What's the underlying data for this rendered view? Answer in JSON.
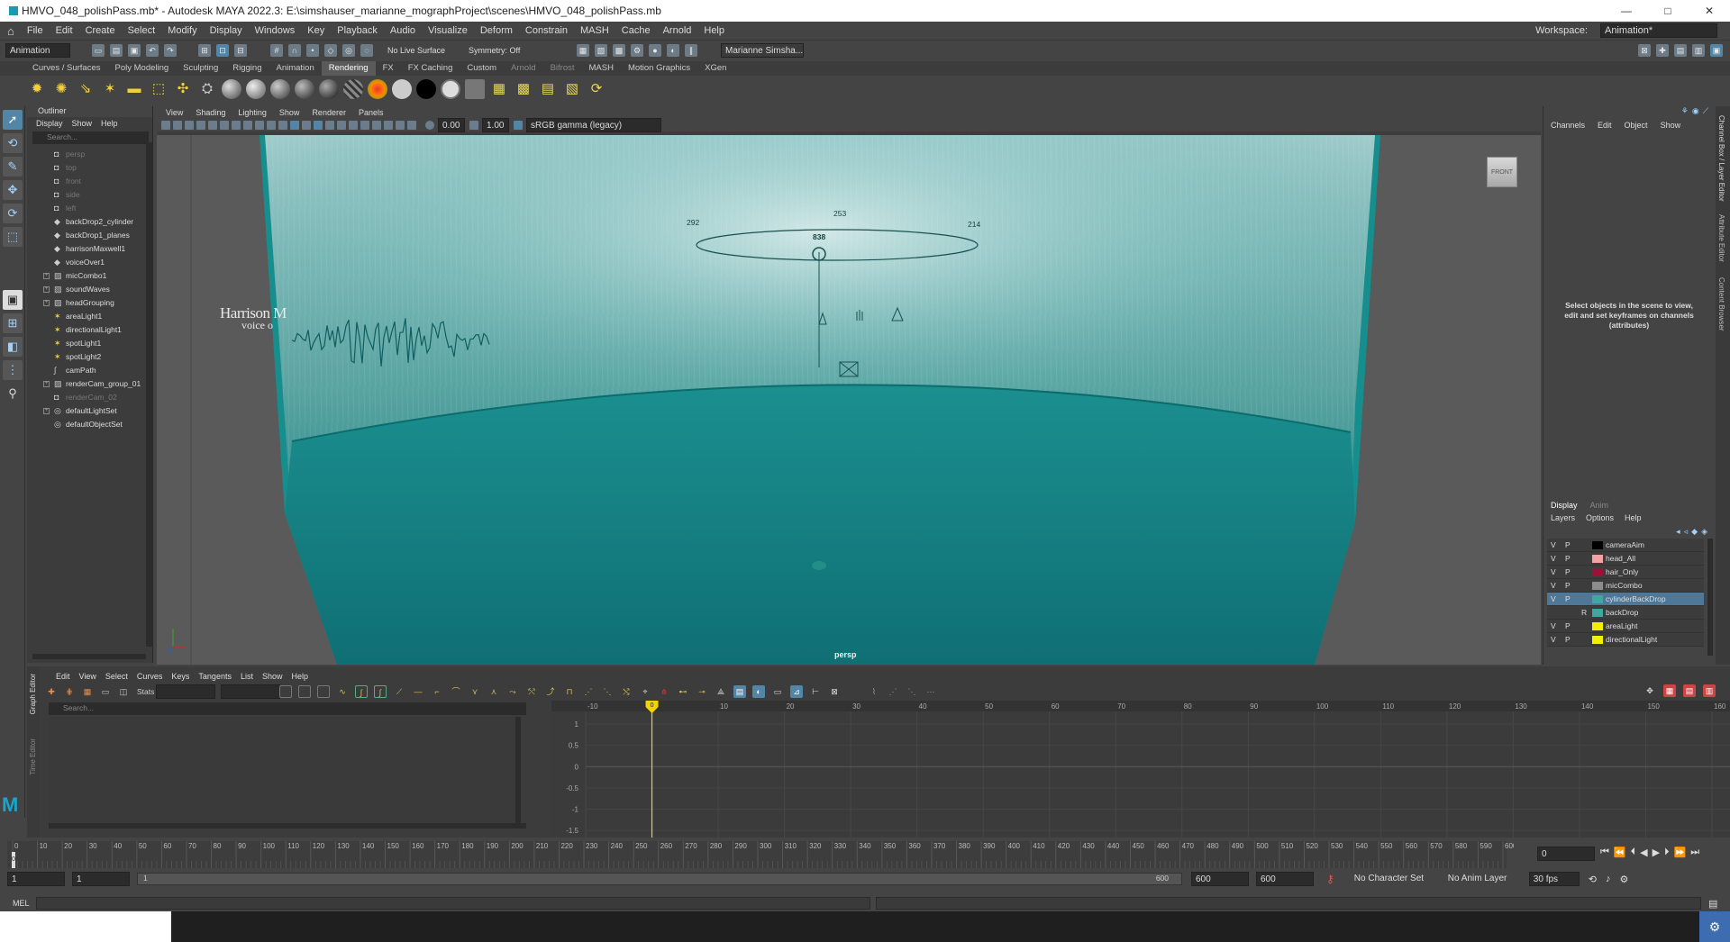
{
  "window": {
    "title": "HMVO_048_polishPass.mb* - Autodesk MAYA 2022.3: E:\\simshauser_marianne_mographProject\\scenes\\HMVO_048_polishPass.mb",
    "controls": [
      "—",
      "□",
      "✕"
    ]
  },
  "menubar": [
    "File",
    "Edit",
    "Create",
    "Select",
    "Modify",
    "Display",
    "Windows",
    "Key",
    "Playback",
    "Audio",
    "Visualize",
    "Deform",
    "Constrain",
    "MASH",
    "Cache",
    "Arnold",
    "Help"
  ],
  "workspace": {
    "label": "Workspace:",
    "value": "Animation*"
  },
  "statusline": {
    "menuset": "Animation",
    "live_surface": "No Live Surface",
    "symmetry": "Symmetry: Off",
    "user": "Marianne Simsha..."
  },
  "shelf_tabs": [
    "Curves / Surfaces",
    "Poly Modeling",
    "Sculpting",
    "Rigging",
    "Animation",
    "Rendering",
    "FX",
    "FX Caching",
    "Custom",
    "Arnold",
    "Bifrost",
    "MASH",
    "Motion Graphics",
    "XGen"
  ],
  "shelf_active": "Rendering",
  "outliner": {
    "tab": "Outliner",
    "menu": [
      "Display",
      "Show",
      "Help"
    ],
    "search_placeholder": "Search...",
    "items": [
      {
        "label": "persp",
        "icon": "camera-icon",
        "grey": true,
        "expandable": false
      },
      {
        "label": "top",
        "icon": "camera-icon",
        "grey": true,
        "expandable": false
      },
      {
        "label": "front",
        "icon": "camera-icon",
        "grey": true,
        "expandable": false
      },
      {
        "label": "side",
        "icon": "camera-icon",
        "grey": true,
        "expandable": false
      },
      {
        "label": "left",
        "icon": "camera-icon",
        "grey": true,
        "expandable": false
      },
      {
        "label": "backDrop2_cylinder",
        "icon": "mesh-icon",
        "grey": false,
        "expandable": false
      },
      {
        "label": "backDrop1_planes",
        "icon": "mesh-icon",
        "grey": false,
        "expandable": false
      },
      {
        "label": "harrisonMaxwell1",
        "icon": "mesh-icon",
        "grey": false,
        "expandable": false
      },
      {
        "label": "voiceOver1",
        "icon": "mesh-icon",
        "grey": false,
        "expandable": false
      },
      {
        "label": "micCombo1",
        "icon": "group-icon",
        "grey": false,
        "expandable": true
      },
      {
        "label": "soundWaves",
        "icon": "group-icon",
        "grey": false,
        "expandable": true
      },
      {
        "label": "headGrouping",
        "icon": "group-icon",
        "grey": false,
        "expandable": true
      },
      {
        "label": "areaLight1",
        "icon": "light-icon",
        "grey": false,
        "expandable": false
      },
      {
        "label": "directionalLight1",
        "icon": "light-icon",
        "grey": false,
        "expandable": false
      },
      {
        "label": "spotLight1",
        "icon": "light-icon",
        "grey": false,
        "expandable": false
      },
      {
        "label": "spotLight2",
        "icon": "light-icon",
        "grey": false,
        "expandable": false
      },
      {
        "label": "camPath",
        "icon": "curve-icon",
        "grey": false,
        "expandable": false
      },
      {
        "label": "renderCam_group_01",
        "icon": "group-icon",
        "grey": false,
        "expandable": true
      },
      {
        "label": "renderCam_02",
        "icon": "camera-icon",
        "grey": true,
        "expandable": false
      },
      {
        "label": "defaultLightSet",
        "icon": "set-icon",
        "grey": false,
        "expandable": true
      },
      {
        "label": "defaultObjectSet",
        "icon": "set-icon",
        "grey": false,
        "expandable": false
      }
    ]
  },
  "viewport": {
    "menu": [
      "View",
      "Shading",
      "Lighting",
      "Show",
      "Renderer",
      "Panels"
    ],
    "exposure": "0.00",
    "gamma": "1.00",
    "color_space": "sRGB gamma (legacy)",
    "camera_label": "persp",
    "viewcube": "FRONT",
    "frame_numbers": [
      "292",
      "253",
      "214",
      "838"
    ],
    "text_in_scene": [
      "Harrison M",
      "voice o"
    ]
  },
  "channel_box": {
    "menu": [
      "Channels",
      "Edit",
      "Object",
      "Show"
    ],
    "message": "Select objects in the scene to view, edit and set keyframes on channels (attributes)"
  },
  "side_tabs": [
    "Channel Box / Layer Editor",
    "Attribute Editor",
    "Content Browser"
  ],
  "layer_editor": {
    "tabs": [
      "Display",
      "Anim"
    ],
    "menu": [
      "Layers",
      "Options",
      "Help"
    ],
    "layers": [
      {
        "v": "V",
        "p": "P",
        "r": "",
        "name": "cameraAim",
        "color": "#000000",
        "selected": false
      },
      {
        "v": "V",
        "p": "P",
        "r": "",
        "name": "head_All",
        "color": "#f4a3a3",
        "selected": false
      },
      {
        "v": "V",
        "p": "P",
        "r": "",
        "name": "hair_Only",
        "color": "#9b1236",
        "selected": false
      },
      {
        "v": "V",
        "p": "P",
        "r": "",
        "name": "micCombo",
        "color": "#8c8c8c",
        "selected": false
      },
      {
        "v": "V",
        "p": "P",
        "r": "",
        "name": "cylinderBackDrop",
        "color": "#3fa6a0",
        "selected": true
      },
      {
        "v": "",
        "p": "",
        "r": "R",
        "name": "backDrop",
        "color": "#3fa6a0",
        "selected": false
      },
      {
        "v": "V",
        "p": "P",
        "r": "",
        "name": "areaLight",
        "color": "#f0f000",
        "selected": false
      },
      {
        "v": "V",
        "p": "P",
        "r": "",
        "name": "directionalLight",
        "color": "#f0f000",
        "selected": false
      }
    ]
  },
  "graph_editor": {
    "side_tabs": [
      "Graph Editor",
      "Time Editor"
    ],
    "menu": [
      "Edit",
      "View",
      "Select",
      "Curves",
      "Keys",
      "Tangents",
      "List",
      "Show",
      "Help"
    ],
    "stats_label": "Stats",
    "search_placeholder": "Search...",
    "x_ticks": [
      "-10",
      "0",
      "10",
      "20",
      "30",
      "40",
      "50",
      "60",
      "70",
      "80",
      "90",
      "100",
      "110",
      "120",
      "130",
      "140",
      "150",
      "160"
    ],
    "y_ticks": [
      "1",
      "0.5",
      "0",
      "-0.5",
      "-1",
      "-1.5"
    ],
    "current_frame": "0"
  },
  "time_slider": {
    "ticks": [
      "0",
      "10",
      "20",
      "30",
      "40",
      "50",
      "60",
      "70",
      "80",
      "90",
      "100",
      "110",
      "120",
      "130",
      "140",
      "150",
      "160",
      "170",
      "180",
      "190",
      "200",
      "210",
      "220",
      "230",
      "240",
      "250",
      "260",
      "270",
      "280",
      "290",
      "300",
      "310",
      "320",
      "330",
      "340",
      "350",
      "360",
      "370",
      "380",
      "390",
      "400",
      "410",
      "420",
      "430",
      "440",
      "450",
      "460",
      "470",
      "480",
      "490",
      "500",
      "510",
      "520",
      "530",
      "540",
      "550",
      "560",
      "570",
      "580",
      "590",
      "600"
    ],
    "current_frame": "0"
  },
  "range_slider": {
    "start": "1",
    "inner_start": "1",
    "range_start_label": "1",
    "range_end_label": "600",
    "end": "600",
    "outer_end": "600",
    "character_set": "No Character Set",
    "anim_layer": "No Anim Layer",
    "fps": "30 fps"
  },
  "command_line": {
    "label": "MEL"
  },
  "colors": {
    "accent": "#5285a6",
    "teal": "#1a9a9a",
    "playhead": "#f5d300"
  }
}
